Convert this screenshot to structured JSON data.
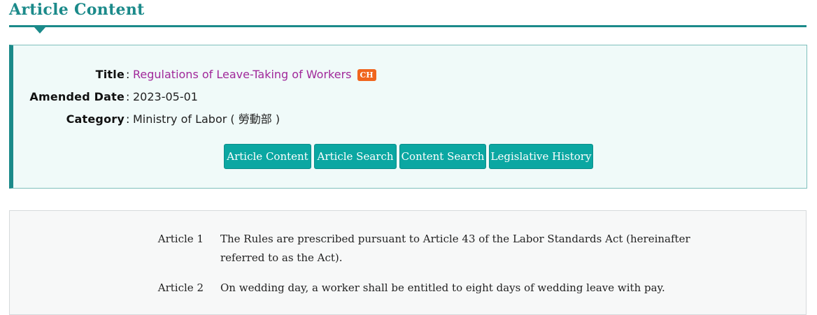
{
  "header": {
    "title": "Article Content"
  },
  "info": {
    "title_label": "Title",
    "title_value": "Regulations of Leave-Taking of Workers",
    "lang_badge": "CH",
    "amended_label": "Amended Date",
    "amended_value": "2023-05-01",
    "category_label": "Category",
    "category_value": "Ministry of Labor ( 勞動部 )",
    "colon": ":"
  },
  "buttons": {
    "article_content": "Article Content",
    "article_search": "Article Search",
    "content_search": "Content Search",
    "legislative_history": "Legislative History"
  },
  "articles": [
    {
      "number": "Article 1",
      "text": "The Rules are prescribed pursuant to Article 43 of the Labor Standards Act (hereinafter referred to as the Act)."
    },
    {
      "number": "Article 2",
      "text": "On wedding day, a worker shall be entitled to eight days of wedding leave with pay."
    }
  ],
  "colors": {
    "accent": "#1b8a8a",
    "button": "#0ba7a2",
    "link": "#a0289a",
    "badge": "#f0651e"
  }
}
